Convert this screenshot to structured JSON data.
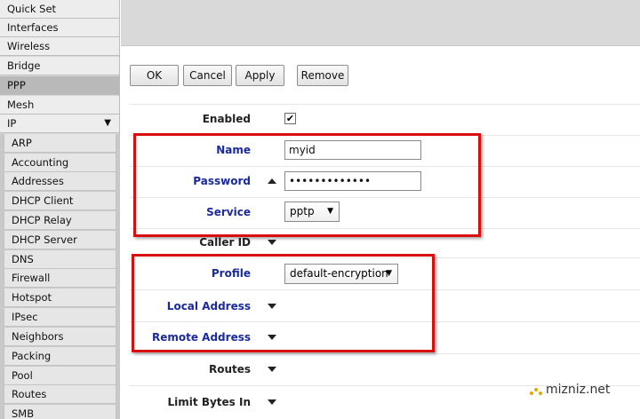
{
  "sidebar": {
    "items": [
      {
        "label": "Quick Set"
      },
      {
        "label": "Interfaces"
      },
      {
        "label": "Wireless"
      },
      {
        "label": "Bridge"
      },
      {
        "label": "PPP"
      },
      {
        "label": "Mesh"
      },
      {
        "label": "IP"
      }
    ],
    "ip_arrow": "▼",
    "sub_items": [
      {
        "label": "ARP"
      },
      {
        "label": "Accounting"
      },
      {
        "label": "Addresses"
      },
      {
        "label": "DHCP Client"
      },
      {
        "label": "DHCP Relay"
      },
      {
        "label": "DHCP Server"
      },
      {
        "label": "DNS"
      },
      {
        "label": "Firewall"
      },
      {
        "label": "Hotspot"
      },
      {
        "label": "IPsec"
      },
      {
        "label": "Neighbors"
      },
      {
        "label": "Packing"
      },
      {
        "label": "Pool"
      },
      {
        "label": "Routes"
      },
      {
        "label": "SMB"
      }
    ]
  },
  "toolbar": {
    "ok_label": "OK",
    "cancel_label": "Cancel",
    "apply_label": "Apply",
    "remove_label": "Remove"
  },
  "form": {
    "enabled_label": "Enabled",
    "enabled_checked": "✔",
    "name_label": "Name",
    "name_value": "myid",
    "password_label": "Password",
    "password_value": "•••••••••••••",
    "service_label": "Service",
    "service_value": "pptp",
    "caller_id_label": "Caller ID",
    "profile_label": "Profile",
    "profile_value": "default-encryption",
    "local_address_label": "Local Address",
    "remote_address_label": "Remote Address",
    "routes_label": "Routes",
    "limit_bytes_in_label": "Limit Bytes In",
    "select_arrow": "▼"
  },
  "watermark": {
    "text": "mizniz.net"
  },
  "colors": {
    "highlight_box": "#d90f0f",
    "blue_label": "#1a2a9a",
    "active_menu": "#b9b9b9"
  }
}
